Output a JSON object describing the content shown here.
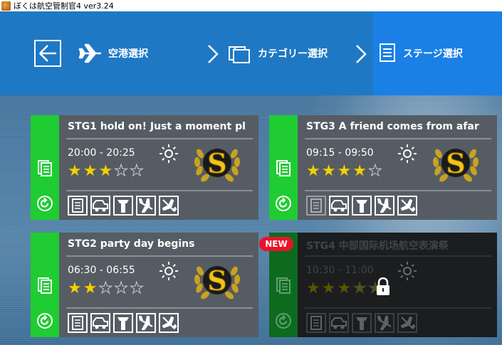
{
  "window": {
    "title": "ぼくは航空管制官4  ver3.24"
  },
  "nav": {
    "airport_label": "空港選択",
    "category_label": "カテゴリー選択",
    "stage_label": "ステージ選択"
  },
  "colors": {
    "nav_bg": "#1f78c4",
    "nav_active": "#1a80e6",
    "card_side": "#1fcc32",
    "card_body": "#565c63",
    "star": "#f4d000",
    "new_badge": "#e8132a"
  },
  "stages": [
    {
      "title": "STG1 hold on! Just a moment pl",
      "time": "20:00 - 20:25",
      "rating": 3,
      "max_rating": 5,
      "rank": "S",
      "weather": "sun-icon",
      "locked": false
    },
    {
      "title": "STG3 A friend comes from afar",
      "time": "09:15 - 09:50",
      "rating": 4,
      "max_rating": 5,
      "rank": "S",
      "weather": "sun-icon",
      "locked": false
    },
    {
      "title": "STG2 party day begins",
      "time": "06:30 - 06:55",
      "rating": 2,
      "max_rating": 5,
      "rank": "S",
      "weather": "sun-icon",
      "locked": false
    },
    {
      "title": "STG4 中部国际机场航空表演祭",
      "time": "10:30 - 11:00",
      "rating": 3,
      "max_rating": 5,
      "weather": "sun-icon",
      "locked": true,
      "new_label": "NEW"
    }
  ]
}
